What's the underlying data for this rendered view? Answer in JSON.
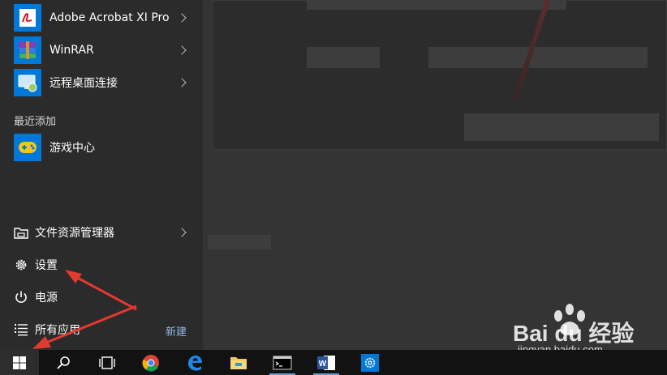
{
  "apps": [
    {
      "label": "Adobe Acrobat XI Pro",
      "icon": "acrobat-icon",
      "has_submenu": true
    },
    {
      "label": "WinRAR",
      "icon": "winrar-icon",
      "has_submenu": true
    },
    {
      "label": "远程桌面连接",
      "icon": "remote-desktop-icon",
      "has_submenu": true
    }
  ],
  "recently_added": {
    "header": "最近添加",
    "items": [
      {
        "label": "游戏中心",
        "icon": "game-center-icon"
      }
    ]
  },
  "system_items": [
    {
      "label": "文件资源管理器",
      "icon": "folder-icon",
      "has_submenu": true
    },
    {
      "label": "设置",
      "icon": "gear-icon",
      "has_submenu": false
    },
    {
      "label": "电源",
      "icon": "power-icon",
      "has_submenu": false
    },
    {
      "label": "所有应用",
      "icon": "list-icon",
      "has_submenu": false
    }
  ],
  "all_apps_new_badge": "新建",
  "taskbar": {
    "items": [
      "start-icon",
      "search-icon",
      "task-view-icon",
      "chrome-icon",
      "edge-icon",
      "file-explorer-icon",
      "cmd-icon",
      "word-icon",
      "settings-icon"
    ]
  },
  "watermark": {
    "brand": "Bai du 经验",
    "url": "jingyan.baidu.com"
  },
  "colors": {
    "accent": "#0078d7",
    "menu_bg": "#2b2b2b",
    "taskbar_bg": "#121212",
    "annotation_arrow": "#e23a2e"
  }
}
